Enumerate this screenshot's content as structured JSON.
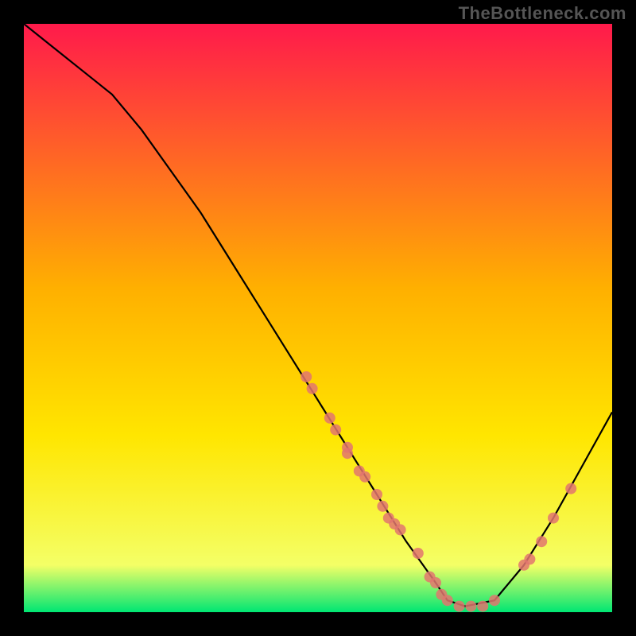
{
  "watermark": "TheBottleneck.com",
  "chart_data": {
    "type": "line",
    "title": "",
    "xlabel": "",
    "ylabel": "",
    "xlim": [
      0,
      100
    ],
    "ylim": [
      0,
      100
    ],
    "grid": false,
    "background_gradient": {
      "top_color": "#ff1a4b",
      "mid_color": "#ffd400",
      "bottom_color": "#00e673"
    },
    "series": [
      {
        "name": "bottleneck-curve",
        "type": "line",
        "color": "#000000",
        "x": [
          0,
          5,
          10,
          15,
          20,
          25,
          30,
          35,
          40,
          45,
          50,
          55,
          60,
          65,
          70,
          72,
          75,
          80,
          85,
          90,
          95,
          100
        ],
        "y": [
          100,
          96,
          92,
          88,
          82,
          75,
          68,
          60,
          52,
          44,
          36,
          28,
          20,
          12,
          5,
          2,
          1,
          2,
          8,
          16,
          25,
          34
        ]
      },
      {
        "name": "highlight-points",
        "type": "scatter",
        "color": "#e2766e",
        "x": [
          48,
          49,
          52,
          53,
          55,
          55,
          57,
          58,
          60,
          61,
          62,
          63,
          64,
          67,
          69,
          70,
          71,
          72,
          74,
          76,
          78,
          80,
          85,
          86,
          88,
          90,
          93
        ],
        "y": [
          40,
          38,
          33,
          31,
          28,
          27,
          24,
          23,
          20,
          18,
          16,
          15,
          14,
          10,
          6,
          5,
          3,
          2,
          1,
          1,
          1,
          2,
          8,
          9,
          12,
          16,
          21
        ]
      }
    ]
  }
}
